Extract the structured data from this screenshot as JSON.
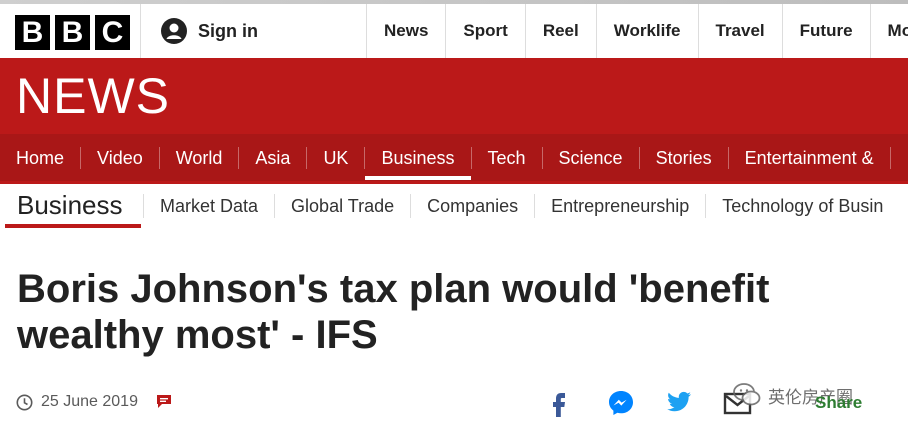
{
  "logo": {
    "letters": [
      "B",
      "B",
      "C"
    ]
  },
  "topbar": {
    "signin": "Sign in",
    "nav": [
      "News",
      "Sport",
      "Reel",
      "Worklife",
      "Travel",
      "Future",
      "Mo"
    ]
  },
  "brand": {
    "title": "NEWS"
  },
  "main_nav": {
    "items": [
      "Home",
      "Video",
      "World",
      "Asia",
      "UK",
      "Business",
      "Tech",
      "Science",
      "Stories",
      "Entertainment &"
    ],
    "active": "Business"
  },
  "section": {
    "title": "Business",
    "subnav": [
      "Market Data",
      "Global Trade",
      "Companies",
      "Entrepreneurship",
      "Technology of Busin"
    ]
  },
  "article": {
    "headline": "Boris Johnson's tax plan would 'benefit wealthy most' - IFS",
    "date": "25 June 2019"
  },
  "share": {
    "label": "Share"
  },
  "watermark": {
    "text": "英伦房产圈"
  },
  "colors": {
    "brand_red": "#bb1919",
    "nav_red": "#a91717",
    "share_green": "#2e7d32"
  },
  "icons": [
    "user-icon",
    "clock-icon",
    "comment-flag-icon",
    "facebook-icon",
    "messenger-icon",
    "twitter-icon",
    "email-icon",
    "share-icon",
    "wechat-icon"
  ]
}
